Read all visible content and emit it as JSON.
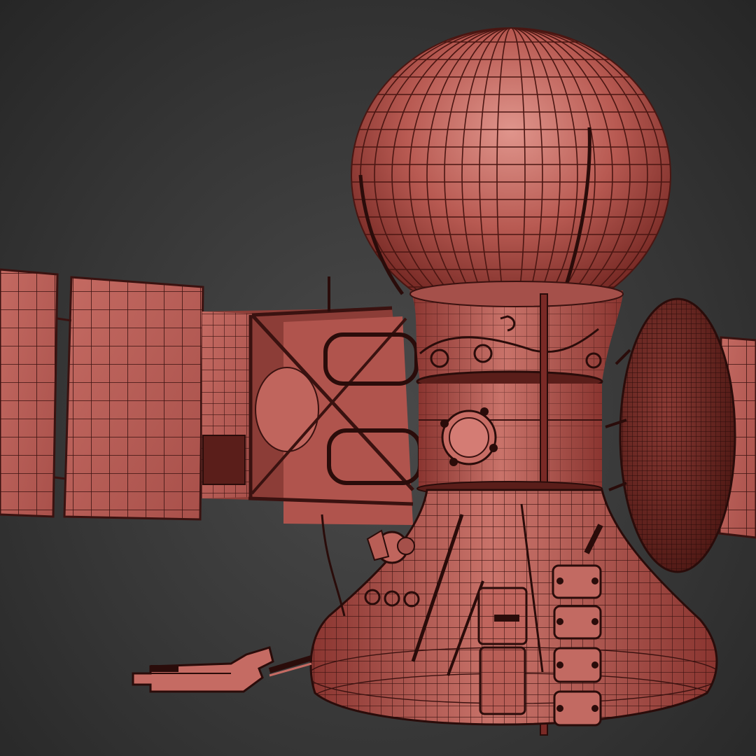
{
  "scene": {
    "subject": "spacecraft-wireframe-model",
    "colors": {
      "background_center": "#4a4a4a",
      "background_edge": "#262626",
      "surface": "#b5514b",
      "surface_light": "#d98a82",
      "surface_dark": "#7a2a26",
      "wire": "#3a1210",
      "shadow": "#4a1612"
    }
  }
}
